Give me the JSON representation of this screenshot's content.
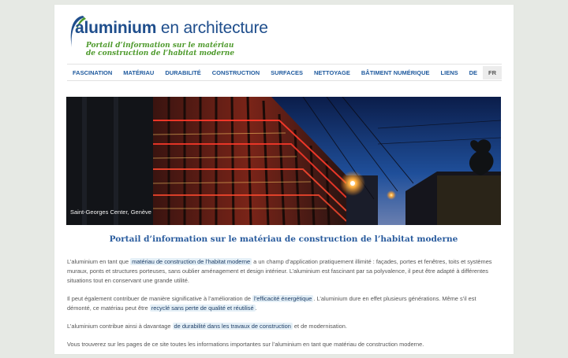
{
  "logo": {
    "title_bold": "aluminium",
    "title_rest": "en architecture",
    "subtitle_line1": "Portail d’information sur le matériau",
    "subtitle_line2": "de construction de l’habitat moderne"
  },
  "nav": {
    "items": [
      {
        "label": "FASCINATION"
      },
      {
        "label": "MATÉRIAU"
      },
      {
        "label": "DURABILITÉ"
      },
      {
        "label": "CONSTRUCTION"
      },
      {
        "label": "SURFACES"
      },
      {
        "label": "NETTOYAGE"
      },
      {
        "label": "BÂTIMENT NUMÉRIQUE"
      },
      {
        "label": "LIENS"
      },
      {
        "label": "DE"
      },
      {
        "label": "FR"
      }
    ],
    "active": "FR"
  },
  "hero": {
    "caption": "Saint-Georges Center, Genève"
  },
  "headline": "Portail d’information sur le matériau de construction de l’habitat moderne",
  "content": {
    "p1_a": "L’aluminium en tant que",
    "p1_link": "matériau de construction de l’habitat moderne",
    "p1_b": "a un champ d’application pratiquement illimité : façades, portes et fenêtres, toits et systèmes muraux, ponts et structures porteuses, sans oublier aménagement et design intérieur. L’aluminium est fascinant par sa polyvalence, il peut être adapté à différentes situations tout en conservant une grande utilité.",
    "p2_a": "Il peut également contribuer de manière significative à l’amélioration de",
    "p2_link1": "l’efficacité énergétique",
    "p2_b": ". L’aluminium dure en effet plusieurs générations. Même s’il est démonté, ce matériau peut être",
    "p2_link2": "recyclé sans perte de qualité et réutilisé",
    "p2_c": ".",
    "p3_a": "L’aluminium contribue ainsi à davantage",
    "p3_link": "de durabilité dans les travaux de construction",
    "p3_b": "et de modernisation.",
    "p4": "Vous trouverez sur les pages de ce site toutes les informations importantes sur l’aluminium en tant que matériau de construction moderne."
  },
  "colors": {
    "brand_blue": "#1f4e8c",
    "brand_green": "#4e9a2c",
    "link_bg": "#e5f0f7",
    "page_bg": "#e6e9e4"
  }
}
